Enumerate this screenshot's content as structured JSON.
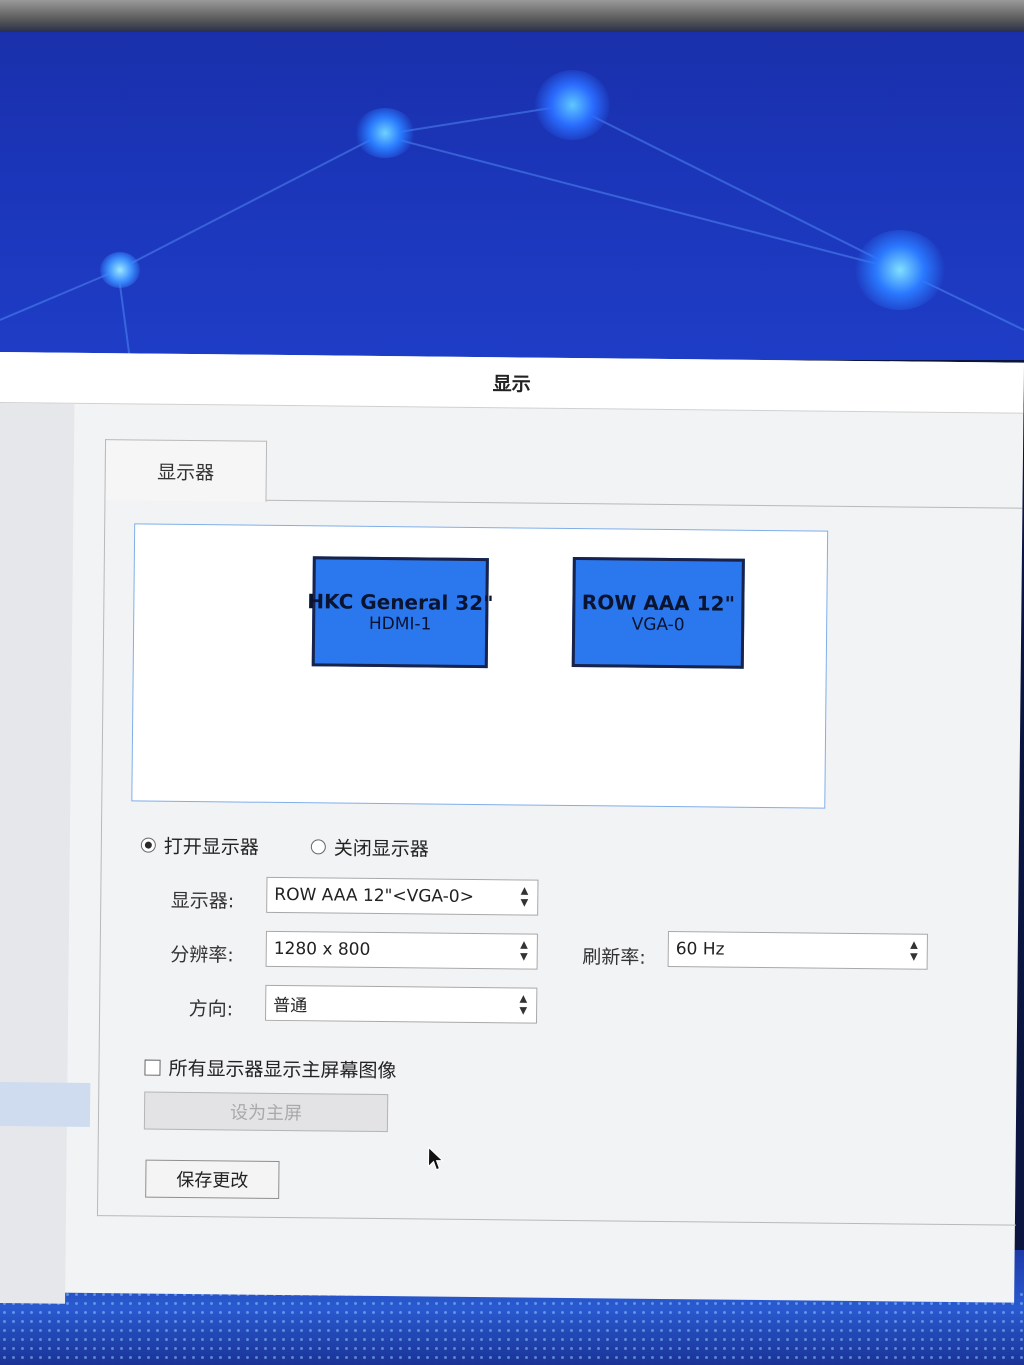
{
  "window": {
    "title": "显示"
  },
  "tab": {
    "label": "显示器"
  },
  "monitors": [
    {
      "name": "HKC General 32\"",
      "port": "HDMI-1"
    },
    {
      "name": "ROW AAA 12\"",
      "port": "VGA-0"
    }
  ],
  "power": {
    "on_label": "打开显示器",
    "off_label": "关闭显示器",
    "selected": "on"
  },
  "settings": {
    "monitor_label": "显示器:",
    "monitor_value": "ROW AAA 12\"<VGA-0>",
    "resolution_label": "分辨率:",
    "resolution_value": "1280 x 800",
    "orientation_label": "方向:",
    "orientation_value": "普通",
    "refresh_label": "刷新率:",
    "refresh_value": "60 Hz"
  },
  "mirror": {
    "label": "所有显示器显示主屏幕图像",
    "checked": false
  },
  "buttons": {
    "set_primary": "设为主屏",
    "save": "保存更改"
  },
  "colors": {
    "monitor_fill": "#2b78ee",
    "canvas_border": "#7faee8"
  }
}
